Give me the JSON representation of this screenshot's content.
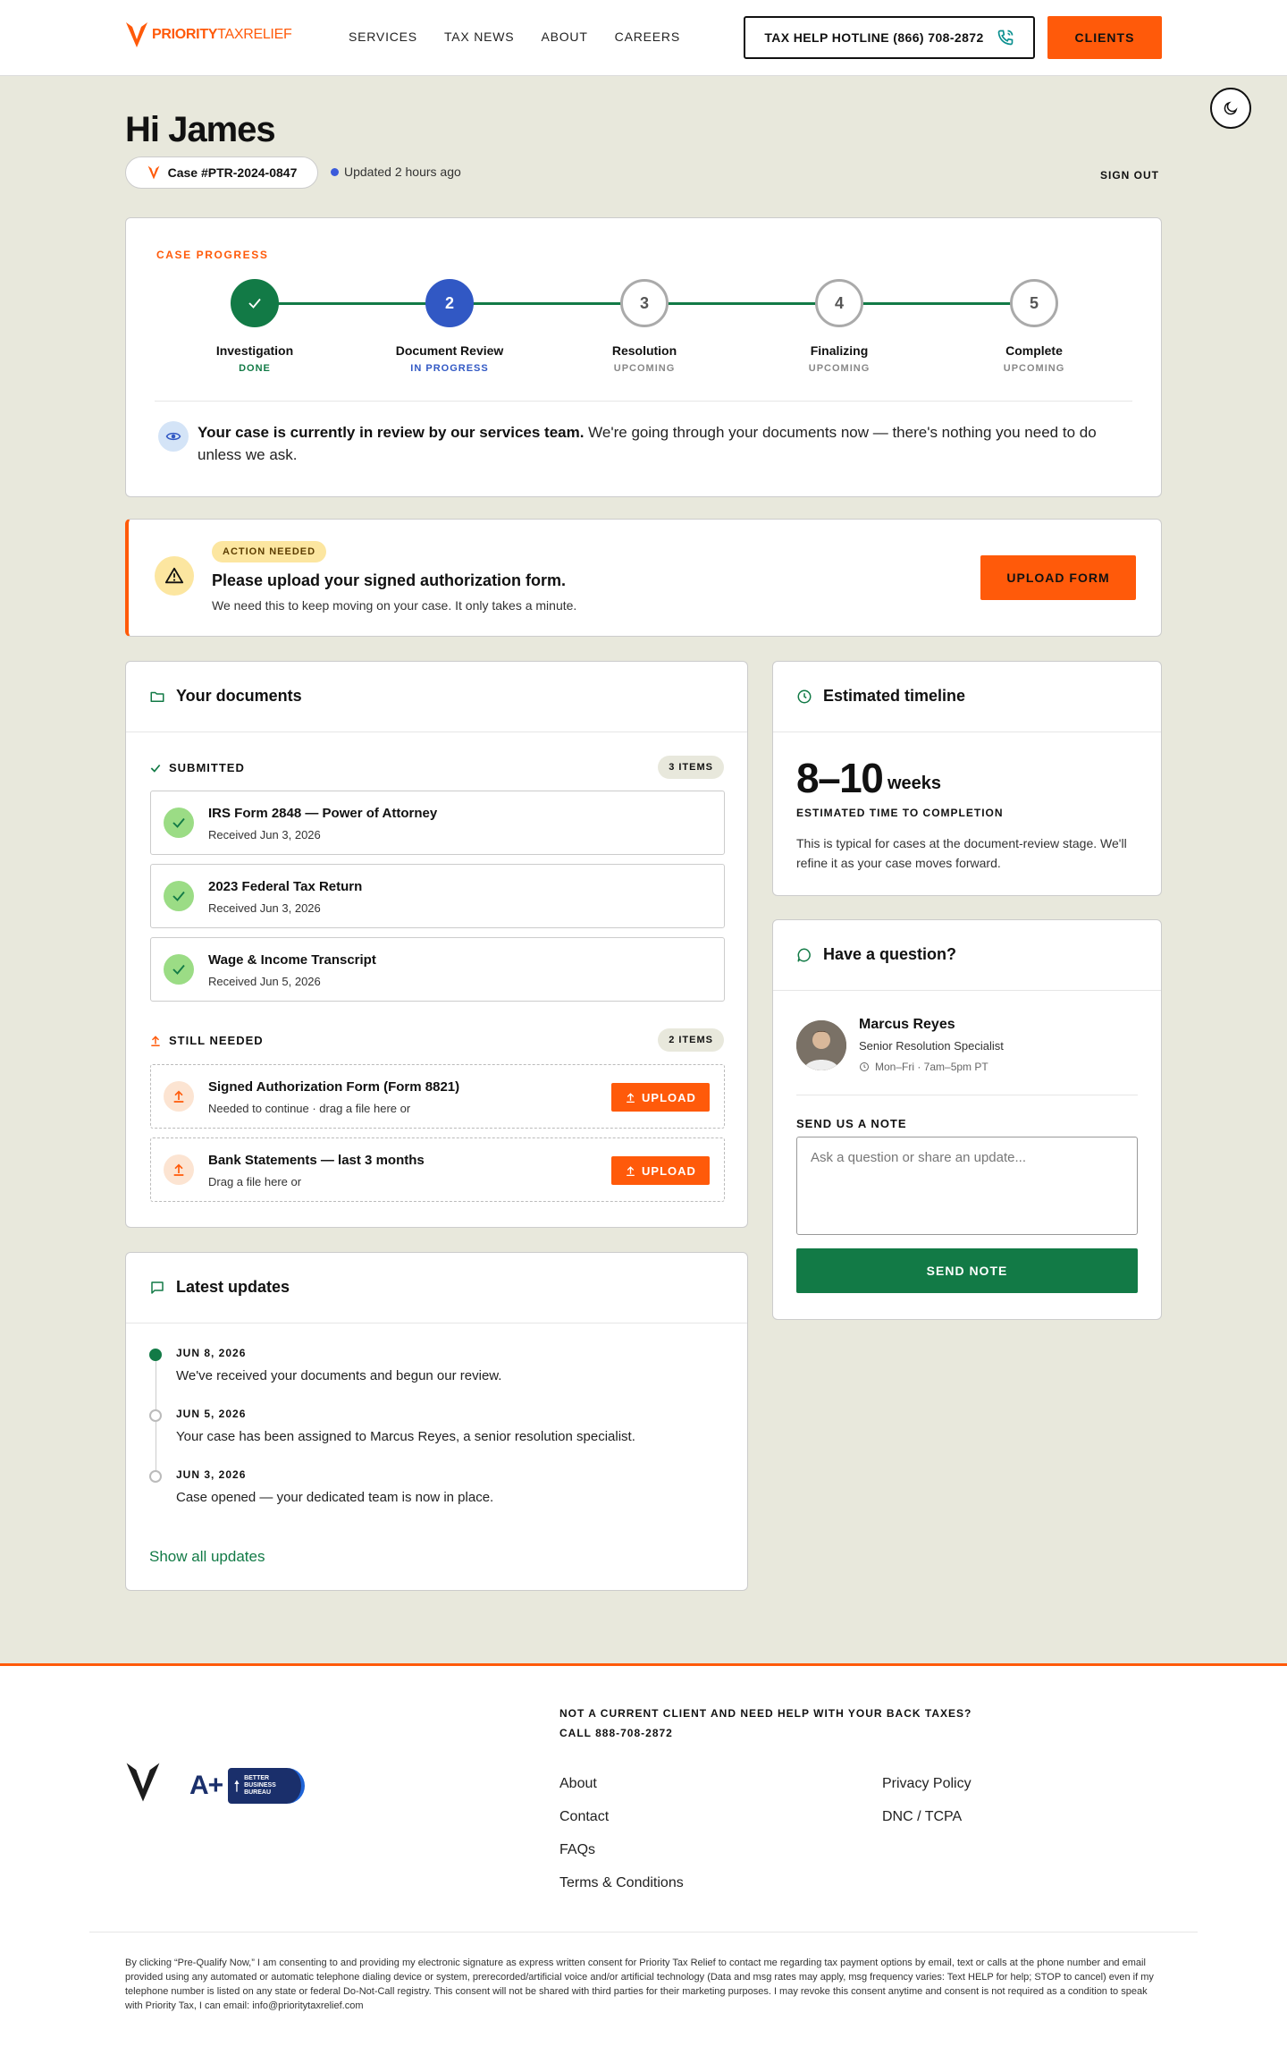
{
  "header": {
    "logo_bold": "PRIORITY",
    "logo_light": "TAXRELIEF",
    "nav": [
      "SERVICES",
      "TAX NEWS",
      "ABOUT",
      "CAREERS"
    ],
    "hotline": "TAX HELP HOTLINE (866) 708-2872",
    "clients": "CLIENTS"
  },
  "dashboard": {
    "greeting": "Hi James",
    "case_number": "Case #PTR-2024-0847",
    "updated": "Updated 2 hours ago",
    "sign_out": "SIGN OUT"
  },
  "progress": {
    "label": "CASE PROGRESS",
    "steps": [
      {
        "num": "1",
        "name": "Investigation",
        "status": "DONE"
      },
      {
        "num": "2",
        "name": "Document Review",
        "status": "IN PROGRESS"
      },
      {
        "num": "3",
        "name": "Resolution",
        "status": "UPCOMING"
      },
      {
        "num": "4",
        "name": "Finalizing",
        "status": "UPCOMING"
      },
      {
        "num": "5",
        "name": "Complete",
        "status": "UPCOMING"
      }
    ],
    "message_bold": "Your case is currently in review by our services team.",
    "message_rest": " We're going through your documents now — there's nothing you need to do unless we ask."
  },
  "action": {
    "badge": "ACTION NEEDED",
    "title": "Please upload your signed authorization form.",
    "subtitle": "We need this to keep moving on your case. It only takes a minute.",
    "button": "UPLOAD FORM"
  },
  "documents": {
    "title": "Your documents",
    "submitted_label": "SUBMITTED",
    "submitted_count": "3 ITEMS",
    "submitted": [
      {
        "name": "IRS Form 2848 — Power of Attorney",
        "detail": "Received Jun 3, 2026"
      },
      {
        "name": "2023 Federal Tax Return",
        "detail": "Received Jun 3, 2026"
      },
      {
        "name": "Wage & Income Transcript",
        "detail": "Received Jun 5, 2026"
      }
    ],
    "needed_label": "STILL NEEDED",
    "needed_count": "2 ITEMS",
    "needed": [
      {
        "name": "Signed Authorization Form (Form 8821)",
        "detail": "Needed to continue · drag a file here or",
        "button": "UPLOAD"
      },
      {
        "name": "Bank Statements — last 3 months",
        "detail": "Drag a file here or",
        "button": "UPLOAD"
      }
    ]
  },
  "timeline": {
    "title": "Estimated timeline",
    "range": "8–10",
    "unit": "weeks",
    "label": "ESTIMATED TIME TO COMPLETION",
    "desc": "This is typical for cases at the document-review stage. We'll refine it as your case moves forward."
  },
  "question": {
    "title": "Have a question?",
    "agent_name": "Marcus Reyes",
    "agent_role": "Senior Resolution Specialist",
    "agent_hours": "Mon–Fri · 7am–5pm PT",
    "note_label": "SEND US A NOTE",
    "note_placeholder": "Ask a question or share an update...",
    "send": "SEND NOTE"
  },
  "updates": {
    "title": "Latest updates",
    "items": [
      {
        "date": "JUN 8, 2026",
        "text": "We've received your documents and begun our review."
      },
      {
        "date": "JUN 5, 2026",
        "text": "Your case has been assigned to Marcus Reyes, a senior resolution specialist."
      },
      {
        "date": "JUN 3, 2026",
        "text": "Case opened — your dedicated team is now in place."
      }
    ],
    "show_all": "Show all updates"
  },
  "footer": {
    "cta_line1": "NOT A CURRENT CLIENT AND NEED HELP WITH YOUR BACK TAXES?",
    "cta_line2": "CALL 888-708-2872",
    "bbb_rating": "A+",
    "bbb_text": "BETTER BUSINESS BUREAU",
    "links_col1": [
      "About",
      "Contact",
      "FAQs",
      "Terms & Conditions"
    ],
    "links_col2": [
      "Privacy Policy",
      "DNC / TCPA"
    ],
    "legal": "By clicking “Pre-Qualify Now,” I am consenting to and providing my electronic signature as express written consent for Priority Tax Relief to contact me regarding tax payment options by email, text or calls at the phone number and email provided using any automated or automatic telephone dialing device or system, prerecorded/artificial voice and/or artificial technology (Data and msg rates may apply, msg frequency varies: Text HELP for help; STOP to cancel) even if my telephone number is listed on any state or federal Do-Not-Call registry. This consent will not be shared with third parties for their marketing purposes. I may revoke this consent anytime and consent is not required as a condition to speak with Priority Tax, I can email: info@prioritytaxrelief.com"
  },
  "colors": {
    "brand_orange": "#ff5a0a",
    "success_green": "#127a46",
    "progress_blue": "#3158c4",
    "page_bg": "#e8e8dc"
  },
  "icons": [
    "logo-mark-icon",
    "phone-icon",
    "moon-icon",
    "check-icon",
    "eye-icon",
    "warning-icon",
    "folder-icon",
    "upload-icon",
    "clock-icon",
    "chat-icon"
  ]
}
